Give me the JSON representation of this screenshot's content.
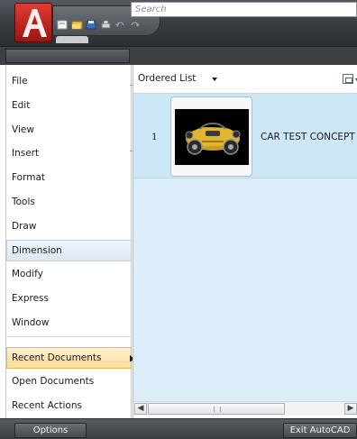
{
  "search": {
    "placeholder": "Search"
  },
  "menu": {
    "items": [
      {
        "label": "File"
      },
      {
        "label": "Edit"
      },
      {
        "label": "View"
      },
      {
        "label": "Insert"
      },
      {
        "label": "Format"
      },
      {
        "label": "Tools"
      },
      {
        "label": "Draw"
      },
      {
        "label": "Dimension"
      },
      {
        "label": "Modify"
      },
      {
        "label": "Express"
      },
      {
        "label": "Window"
      }
    ],
    "recent_documents": "Recent Documents",
    "open_documents": "Open Documents",
    "recent_actions": "Recent Actions"
  },
  "panel": {
    "list_type": "Ordered List",
    "documents": [
      {
        "index": "1",
        "name": "CAR TEST CONCEPT"
      }
    ]
  },
  "footer": {
    "options_label": "Options",
    "exit_label": "Exit AutoCAD"
  },
  "colors": {
    "accent": "#cce8f7",
    "selected": "#fbdc98",
    "brand": "#c8231c"
  }
}
